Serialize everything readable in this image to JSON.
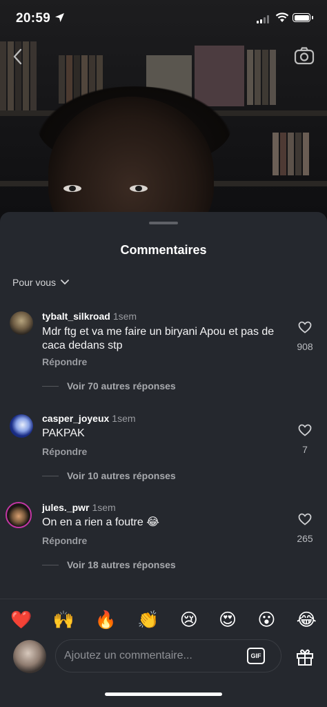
{
  "status_bar": {
    "time": "20:59"
  },
  "sheet": {
    "title": "Commentaires",
    "filter_label": "Pour vous"
  },
  "comments": [
    {
      "username": "tybalt_silkroad",
      "ago": "1sem",
      "text": "Mdr ftg et va me faire un biryani Apou et pas de caca dedans stp",
      "reply_label": "Répondre",
      "more_label": "Voir 70 autres réponses",
      "likes": "908"
    },
    {
      "username": "casper_joyeux",
      "ago": "1sem",
      "text": "PAKPAK",
      "reply_label": "Répondre",
      "more_label": "Voir 10 autres réponses",
      "likes": "7"
    },
    {
      "username": "jules._pwr",
      "ago": "1sem",
      "text": "On en a rien a foutre 😂",
      "reply_label": "Répondre",
      "more_label": "Voir 18 autres réponses",
      "likes": "265"
    }
  ],
  "reactions": [
    "❤️",
    "🙌",
    "🔥",
    "👏",
    "😢",
    "😍",
    "😮",
    "😂"
  ],
  "composer": {
    "placeholder": "Ajoutez un commentaire...",
    "gif_label": "GIF"
  },
  "colors": {
    "sheet_bg": "#25282e",
    "muted_text": "#9a9ca1",
    "heart_red": "#e8303f"
  }
}
